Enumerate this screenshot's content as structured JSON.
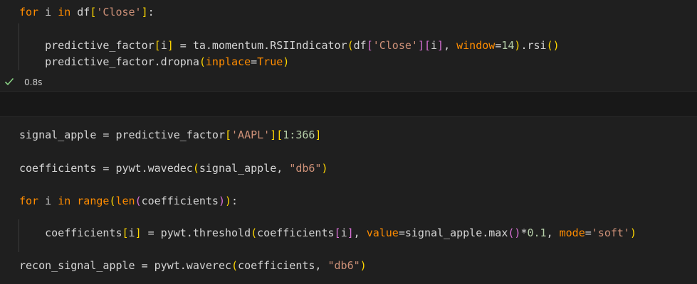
{
  "cell1": {
    "lines": [
      [
        {
          "t": "for",
          "c": "kwo"
        },
        {
          "t": " i ",
          "c": "pn"
        },
        {
          "t": "in",
          "c": "kwo"
        },
        {
          "t": " df",
          "c": "pn"
        },
        {
          "t": "[",
          "c": "br1"
        },
        {
          "t": "'Close'",
          "c": "str"
        },
        {
          "t": "]",
          "c": "br1"
        },
        {
          "t": ":",
          "c": "pn"
        }
      ],
      [],
      [
        {
          "t": "    predictive_factor",
          "c": "pn"
        },
        {
          "t": "[",
          "c": "br1"
        },
        {
          "t": "i",
          "c": "pn"
        },
        {
          "t": "]",
          "c": "br1"
        },
        {
          "t": " = ta.momentum.RSIIndicator",
          "c": "pn"
        },
        {
          "t": "(",
          "c": "br1"
        },
        {
          "t": "df",
          "c": "pn"
        },
        {
          "t": "[",
          "c": "br2"
        },
        {
          "t": "'Close'",
          "c": "str"
        },
        {
          "t": "]",
          "c": "br2"
        },
        {
          "t": "[",
          "c": "br2"
        },
        {
          "t": "i",
          "c": "pn"
        },
        {
          "t": "]",
          "c": "br2"
        },
        {
          "t": ", ",
          "c": "pn"
        },
        {
          "t": "window",
          "c": "kwo"
        },
        {
          "t": "=",
          "c": "pn"
        },
        {
          "t": "14",
          "c": "num"
        },
        {
          "t": ")",
          "c": "br1"
        },
        {
          "t": ".rsi",
          "c": "pn"
        },
        {
          "t": "()",
          "c": "br1"
        }
      ],
      [
        {
          "t": "    predictive_factor.dropna",
          "c": "pn"
        },
        {
          "t": "(",
          "c": "br1"
        },
        {
          "t": "inplace",
          "c": "kwo"
        },
        {
          "t": "=",
          "c": "pn"
        },
        {
          "t": "True",
          "c": "kwo"
        },
        {
          "t": ")",
          "c": "br1"
        }
      ]
    ]
  },
  "status": {
    "icon": "check-icon",
    "time": "0.8s",
    "success_color": "#89d185"
  },
  "cell2": {
    "lines": [
      [],
      [
        {
          "t": "signal_apple = predictive_factor",
          "c": "pn"
        },
        {
          "t": "[",
          "c": "br1"
        },
        {
          "t": "'AAPL'",
          "c": "str"
        },
        {
          "t": "]",
          "c": "br1"
        },
        {
          "t": "[",
          "c": "br1"
        },
        {
          "t": "1:366",
          "c": "num"
        },
        {
          "t": "]",
          "c": "br1"
        }
      ],
      [],
      [
        {
          "t": "coefficients = pywt.wavedec",
          "c": "pn"
        },
        {
          "t": "(",
          "c": "br1"
        },
        {
          "t": "signal_apple, ",
          "c": "pn"
        },
        {
          "t": "\"db6\"",
          "c": "str"
        },
        {
          "t": ")",
          "c": "br1"
        }
      ],
      [],
      [
        {
          "t": "for",
          "c": "kwo"
        },
        {
          "t": " i ",
          "c": "pn"
        },
        {
          "t": "in",
          "c": "kwo"
        },
        {
          "t": " ",
          "c": "pn"
        },
        {
          "t": "range",
          "c": "kwo"
        },
        {
          "t": "(",
          "c": "br1"
        },
        {
          "t": "len",
          "c": "kwo"
        },
        {
          "t": "(",
          "c": "br2"
        },
        {
          "t": "coefficients",
          "c": "pn"
        },
        {
          "t": ")",
          "c": "br2"
        },
        {
          "t": ")",
          "c": "br1"
        },
        {
          "t": ":",
          "c": "pn"
        }
      ],
      [],
      [
        {
          "t": "    coefficients",
          "c": "pn"
        },
        {
          "t": "[",
          "c": "br1"
        },
        {
          "t": "i",
          "c": "pn"
        },
        {
          "t": "]",
          "c": "br1"
        },
        {
          "t": " = pywt.threshold",
          "c": "pn"
        },
        {
          "t": "(",
          "c": "br1"
        },
        {
          "t": "coefficients",
          "c": "pn"
        },
        {
          "t": "[",
          "c": "br2"
        },
        {
          "t": "i",
          "c": "pn"
        },
        {
          "t": "]",
          "c": "br2"
        },
        {
          "t": ", ",
          "c": "pn"
        },
        {
          "t": "value",
          "c": "kwo"
        },
        {
          "t": "=",
          "c": "pn"
        },
        {
          "t": "signal_apple.max",
          "c": "pn"
        },
        {
          "t": "()",
          "c": "br2"
        },
        {
          "t": "*",
          "c": "pn"
        },
        {
          "t": "0.1",
          "c": "num"
        },
        {
          "t": ", ",
          "c": "pn"
        },
        {
          "t": "mode",
          "c": "kwo"
        },
        {
          "t": "=",
          "c": "pn"
        },
        {
          "t": "'soft'",
          "c": "str"
        },
        {
          "t": ")",
          "c": "br1"
        }
      ],
      [],
      [
        {
          "t": "recon_signal_apple = pywt.waverec",
          "c": "pn"
        },
        {
          "t": "(",
          "c": "br1"
        },
        {
          "t": "coefficients, ",
          "c": "pn"
        },
        {
          "t": "\"db6\"",
          "c": "str"
        },
        {
          "t": ")",
          "c": "br1"
        }
      ]
    ]
  }
}
